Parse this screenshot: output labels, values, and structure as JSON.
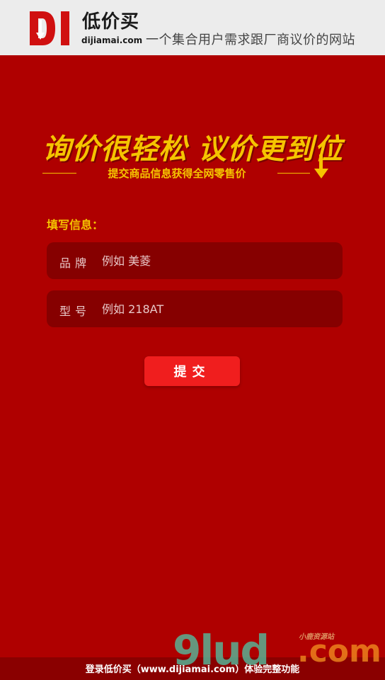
{
  "header": {
    "logo_letters": "DI",
    "brand_name": "低价买",
    "brand_domain": "dijiamai.com",
    "tagline": "一个集合用户需求跟厂商议价的网站"
  },
  "hero": {
    "title": "询价很轻松 议价更到位",
    "subtitle": "提交商品信息获得全网零售价"
  },
  "form": {
    "label": "填写信息：",
    "brand_field": {
      "label": "品牌",
      "placeholder": "例如 美菱"
    },
    "model_field": {
      "label": "型号",
      "placeholder": "例如 218AT"
    },
    "submit_label": "提交"
  },
  "footer": {
    "text": "登录低价买（www.dijiamai.com）体验完整功能"
  },
  "watermark": {
    "main": "9lud",
    "suffix": ".com",
    "small": "小鹿资源站"
  },
  "colors": {
    "background": "#af0000",
    "field_background": "#860000",
    "accent_gold": "#f5c400",
    "button": "#f01e1e",
    "header_bg": "#ececec"
  }
}
